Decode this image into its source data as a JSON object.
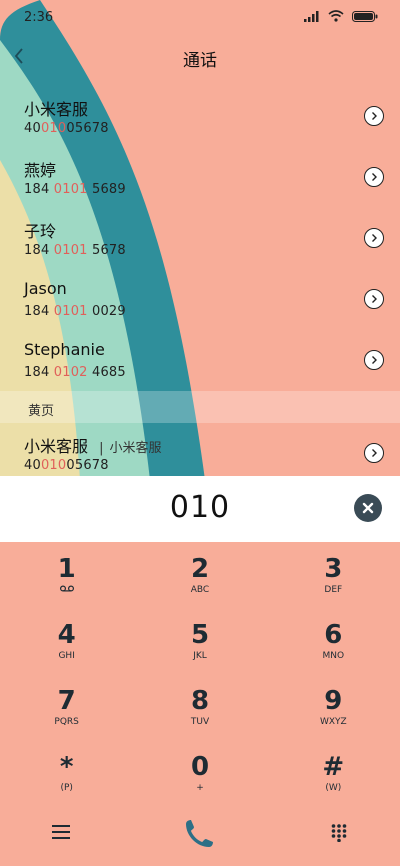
{
  "status": {
    "time": "2:36"
  },
  "header": {
    "title": "通话"
  },
  "contacts": [
    {
      "name": "小米客服",
      "num_pre": "40",
      "num_hl": "010",
      "num_post": "05678"
    },
    {
      "name": "燕婷",
      "num_pre": "184 ",
      "num_hl": "0101",
      "num_post": " 5689"
    },
    {
      "name": "子玲",
      "num_pre": "184 ",
      "num_hl": "0101",
      "num_post": " 5678"
    },
    {
      "name": "Jason",
      "num_pre": "184 ",
      "num_hl": "0101",
      "num_post": " 0029"
    },
    {
      "name": "Stephanie",
      "num_pre": "184 ",
      "num_hl": "0102",
      "num_post": " 4685"
    }
  ],
  "section": {
    "label": "黄页"
  },
  "yellow_page": {
    "name": "小米客服",
    "separator": "|",
    "sub": "小米客服",
    "num_pre": "40",
    "num_hl": "010",
    "num_post": "05678"
  },
  "dial": {
    "value": "010"
  },
  "keys": [
    {
      "digit": "1",
      "letters": ""
    },
    {
      "digit": "2",
      "letters": "ABC"
    },
    {
      "digit": "3",
      "letters": "DEF"
    },
    {
      "digit": "4",
      "letters": "GHI"
    },
    {
      "digit": "5",
      "letters": "JKL"
    },
    {
      "digit": "6",
      "letters": "MNO"
    },
    {
      "digit": "7",
      "letters": "PQRS"
    },
    {
      "digit": "8",
      "letters": "TUV"
    },
    {
      "digit": "9",
      "letters": "WXYZ"
    },
    {
      "digit": "*",
      "letters": "(P)"
    },
    {
      "digit": "0",
      "letters": "+"
    },
    {
      "digit": "#",
      "letters": "(W)"
    }
  ],
  "colors": {
    "background": "#f8ad99",
    "wave_teal": "#2f8f9b",
    "wave_mint": "#9ed9c4",
    "wave_cream": "#ecdfa8",
    "highlight": "#e0605a",
    "call_icon": "#2d6f86"
  }
}
